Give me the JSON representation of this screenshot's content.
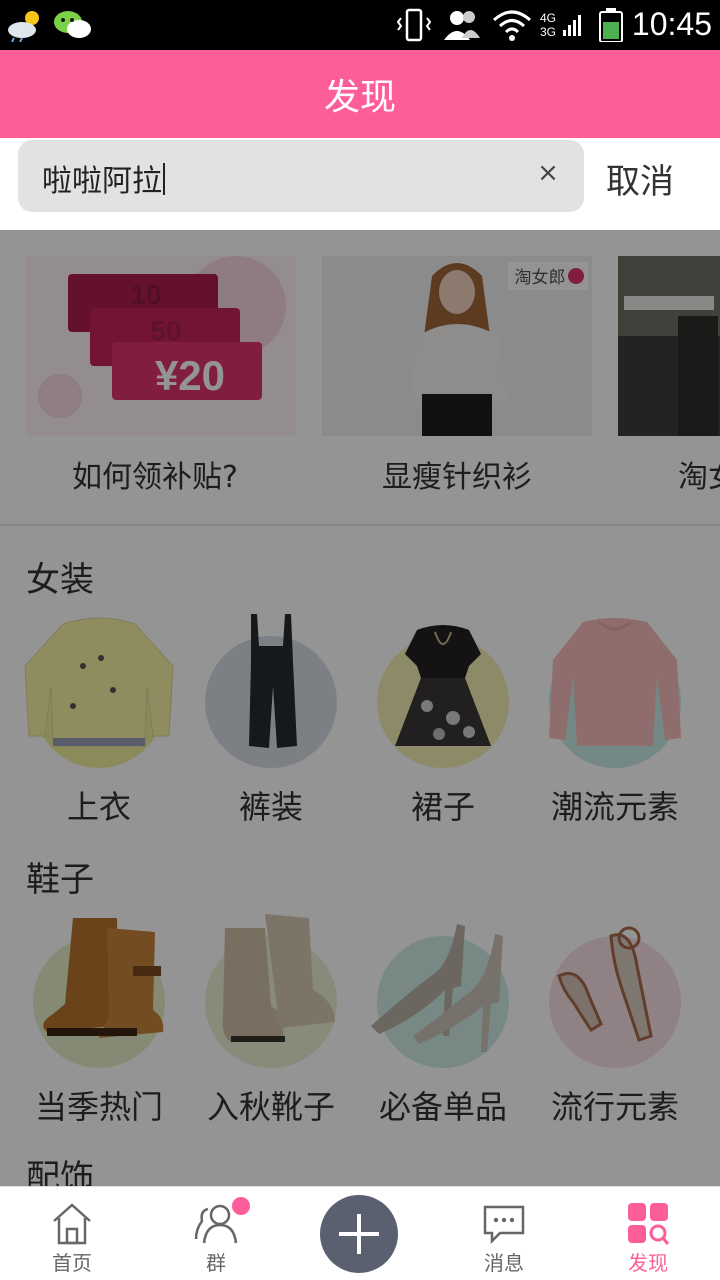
{
  "status_bar": {
    "time": "10:45",
    "network": "4G 3G",
    "icons": [
      "weather-icon",
      "wechat-icon",
      "vibrate-icon",
      "contacts-icon",
      "wifi-icon",
      "signal-icon",
      "battery-icon"
    ]
  },
  "header": {
    "title": "发现"
  },
  "search": {
    "value": "啦啦阿拉",
    "clear": "×",
    "cancel": "取消"
  },
  "banners": [
    {
      "label": "如何领补贴?",
      "coupon_value": "¥20",
      "coupon_values_behind": [
        "10",
        "50"
      ]
    },
    {
      "label": "显瘦针织衫",
      "brand": "淘女郎"
    },
    {
      "label": "淘女"
    }
  ],
  "sections": [
    {
      "title": "女装",
      "items": [
        {
          "label": "上衣",
          "icon": "sweater-icon",
          "color": "#f0ee9e"
        },
        {
          "label": "裤装",
          "icon": "overalls-icon",
          "color": "#d6dde6"
        },
        {
          "label": "裙子",
          "icon": "dress-icon",
          "color": "#f3eeb1"
        },
        {
          "label": "潮流元素",
          "icon": "pink-sweater-icon",
          "color": "#c9eae6"
        }
      ]
    },
    {
      "title": "鞋子",
      "items": [
        {
          "label": "当季热门",
          "icon": "brown-boots-icon",
          "color": "#e6eec9"
        },
        {
          "label": "入秋靴子",
          "icon": "beige-boots-icon",
          "color": "#eaeed2"
        },
        {
          "label": "必备单品",
          "icon": "heels-icon",
          "color": "#cdeae6"
        },
        {
          "label": "流行元素",
          "icon": "sandals-icon",
          "color": "#f6dfe4"
        }
      ]
    },
    {
      "title": "配饰",
      "items": []
    }
  ],
  "bottom_nav": {
    "items": [
      {
        "label": "首页",
        "icon": "home-icon"
      },
      {
        "label": "群",
        "icon": "group-icon"
      },
      {
        "label": "",
        "icon": "plus-icon"
      },
      {
        "label": "消息",
        "icon": "message-icon"
      },
      {
        "label": "发现",
        "icon": "discover-icon"
      }
    ],
    "active": "发现",
    "accent": "#fd5e9a"
  },
  "colors": {
    "brand": "#fd5e9a",
    "overlay": "rgba(0,0,0,0.42)"
  }
}
